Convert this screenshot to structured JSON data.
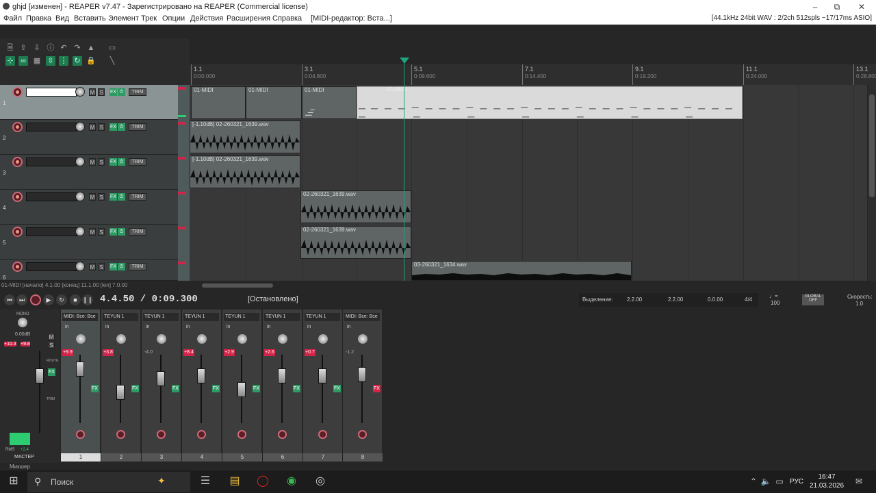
{
  "window": {
    "title": "ghjd [изменен] - REAPER v7.47 - Зарегистрировано на REAPER (Commercial license)"
  },
  "menu": {
    "items": [
      "Файл",
      "Правка",
      "Вид",
      "Вставить",
      "Элемент",
      "Трек",
      "Опции",
      "Действия",
      "Расширения",
      "Справка",
      "[MIDI-редактор: Вста...]"
    ],
    "status": "[44.1kHz 24bit WAV : 2/2ch 512spls ~17/17ms ASIO]"
  },
  "ruler": {
    "marks": [
      {
        "bar": "1.1",
        "time": "0:00.000"
      },
      {
        "bar": "3.1",
        "time": "0:04.800"
      },
      {
        "bar": "5.1",
        "time": "0:09.600"
      },
      {
        "bar": "7.1",
        "time": "0:14.400"
      },
      {
        "bar": "9.1",
        "time": "0:19.200"
      },
      {
        "bar": "11.1",
        "time": "0:24.000"
      },
      {
        "bar": "13.1",
        "time": "0:28.800"
      }
    ]
  },
  "tracks": [
    {
      "num": "1",
      "name": "",
      "selected": true
    },
    {
      "num": "2",
      "name": ""
    },
    {
      "num": "3",
      "name": ""
    },
    {
      "num": "4",
      "name": ""
    },
    {
      "num": "5",
      "name": ""
    },
    {
      "num": "6",
      "name": ""
    }
  ],
  "track_buttons": {
    "m": "M",
    "s": "S",
    "fx": "FX",
    "trim": "TRIM"
  },
  "items": {
    "midi1": "01-MIDI",
    "midi2": "01-MIDI",
    "midi3": "01-MIDI",
    "midi4": "01-MIDI",
    "wav2": "[-1.10dB] 02-260321_1639.wav",
    "wav3": "[-1.10dB] 02-260321_1639.wav",
    "wav4": "02-260321_1639.wav",
    "wav5": "02-260321_1639.wav",
    "wav6": "03-260321_1634.wav"
  },
  "statusline": "01-MIDI [начало] 4.1.00 [конец] 11.1.00 [len] 7.0.00",
  "transport": {
    "time": "4.4.50 / 0:09.300",
    "state": "[Остановлено]",
    "selection_label": "Выделение:",
    "sel_start": "2.2.00",
    "sel_end": "2.2.00",
    "sel_len": "0.0.00",
    "timesig": "4/4",
    "bpm": "100",
    "rate_label": "Скорость:",
    "rate": "1.0"
  },
  "mixer": {
    "master_label": "МАСТЕР",
    "master_db": "0.00dB",
    "master_peak1": "+10.3",
    "master_peak2": "+9.8",
    "rms_label": "RMS",
    "rms_value": "+2.4",
    "mixer_tab": "Микшер",
    "strips": [
      {
        "name": "MIDI: Все: Все",
        "gain": "+9.9",
        "num": "1",
        "selected": true
      },
      {
        "name": "TEYUN 1",
        "gain": "+3.8",
        "num": "2"
      },
      {
        "name": "TEYUN 1",
        "gain": "-4.0",
        "num": "3"
      },
      {
        "name": "TEYUN 1",
        "gain": "+8.4",
        "num": "4"
      },
      {
        "name": "TEYUN 1",
        "gain": "+2.9",
        "num": "5"
      },
      {
        "name": "TEYUN 1",
        "gain": "+2.6",
        "num": "6"
      },
      {
        "name": "TEYUN 1",
        "gain": "+0.7",
        "num": "7"
      },
      {
        "name": "MIDI: Все: Все",
        "gain": "-1.2",
        "num": "8"
      }
    ],
    "strip_in": "in",
    "route": "ROUTE",
    "trim": "TRIM"
  },
  "taskbar": {
    "search_placeholder": "Поиск",
    "lang": "РУС",
    "time": "16:47",
    "date": "21.03.2026"
  }
}
